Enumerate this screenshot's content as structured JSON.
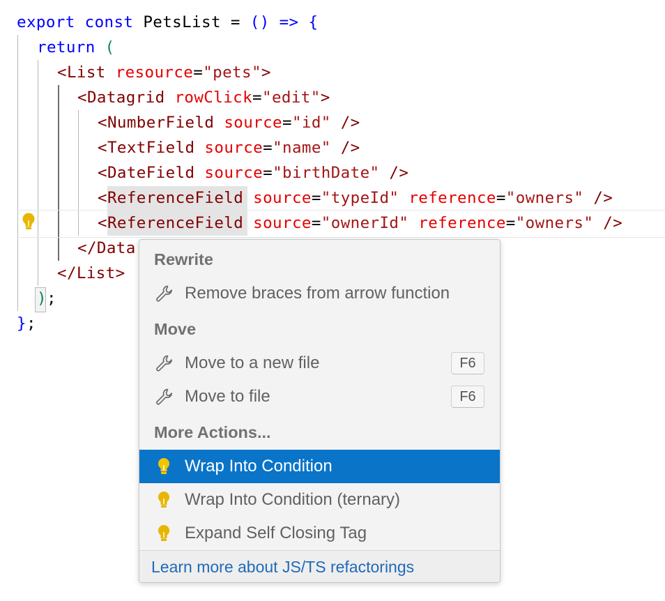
{
  "code": {
    "line1": {
      "export": "export",
      "const": "const",
      "name": "PetsList",
      "eq": " = ",
      "parens": "()",
      "arrow": " => ",
      "brace": "{"
    },
    "line2": {
      "return": "return",
      "paren": "("
    },
    "line3": {
      "open": "<List",
      "attr": "resource",
      "eq": "=",
      "val": "\"pets\"",
      "close": ">"
    },
    "line4": {
      "open": "<Datagrid",
      "attr": "rowClick",
      "eq": "=",
      "val": "\"edit\"",
      "close": ">"
    },
    "line5": {
      "open": "<NumberField",
      "attr": "source",
      "eq": "=",
      "val": "\"id\"",
      "close": " />"
    },
    "line6": {
      "open": "<TextField",
      "attr": "source",
      "eq": "=",
      "val": "\"name\"",
      "close": " />"
    },
    "line7": {
      "open": "<DateField",
      "attr": "source",
      "eq": "=",
      "val": "\"birthDate\"",
      "close": " />"
    },
    "line8": {
      "lt": "<",
      "tag": "ReferenceField",
      "attr1": "source",
      "eq1": "=",
      "val1": "\"typeId\"",
      "attr2": "reference",
      "eq2": "=",
      "val2": "\"owners\"",
      "close": " />"
    },
    "line9": {
      "lt": "<",
      "tag": "ReferenceField",
      "attr1": "source",
      "eq1": "=",
      "val1": "\"ownerId\"",
      "attr2": "reference",
      "eq2": "=",
      "val2": "\"owners\"",
      "close": " />"
    },
    "line10": {
      "text": "</Data"
    },
    "line11": {
      "text": "</List>"
    },
    "line12": {
      "paren": ")",
      "semi": ";"
    },
    "line13": {
      "brace": "}",
      "semi": ";"
    }
  },
  "quick_fix_menu": {
    "sections": [
      {
        "header": "Rewrite",
        "items": [
          {
            "label": "Remove braces from arrow function",
            "icon": "wrench-icon"
          }
        ]
      },
      {
        "header": "Move",
        "items": [
          {
            "label": "Move to a new file",
            "icon": "wrench-icon",
            "shortcut": "F6"
          },
          {
            "label": "Move to file",
            "icon": "wrench-icon",
            "shortcut": "F6"
          }
        ]
      },
      {
        "header": "More Actions...",
        "items": [
          {
            "label": "Wrap Into Condition",
            "icon": "lightbulb-icon",
            "selected": true
          },
          {
            "label": "Wrap Into Condition (ternary)",
            "icon": "lightbulb-icon"
          },
          {
            "label": "Expand Self Closing Tag",
            "icon": "lightbulb-icon"
          }
        ]
      }
    ],
    "footer_link": "Learn more about JS/TS refactorings"
  },
  "colors": {
    "selection": "#0a74c9",
    "lightbulb": "#e8b600",
    "link": "#1f6ab8"
  }
}
